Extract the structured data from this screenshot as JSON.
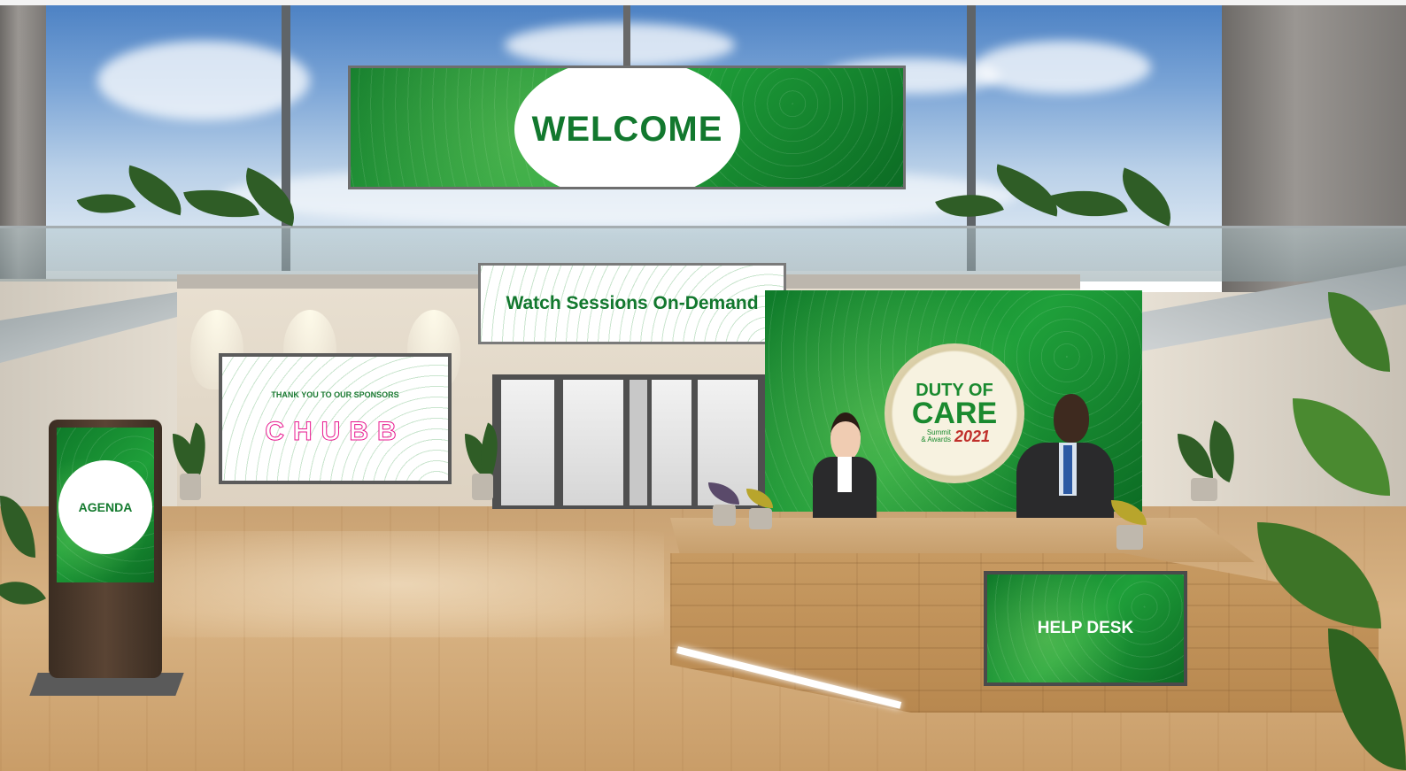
{
  "scene": {
    "welcome_banner": {
      "text": "WELCOME"
    },
    "sessions_sign": {
      "text": "Watch Sessions On-Demand"
    },
    "sponsors_screen": {
      "heading": "THANK YOU TO OUR SPONSORS",
      "sponsor_logo": "CHUBB"
    },
    "event_branding": {
      "line1": "DUTY OF",
      "line2": "CARE",
      "line3a": "Summit",
      "line3b": "& Awards",
      "year": "2021"
    },
    "agenda_kiosk": {
      "label": "AGENDA"
    },
    "help_desk": {
      "label": "HELP DESK"
    }
  },
  "colors": {
    "brand_green": "#12782e",
    "sponsor_magenta": "#e8188f",
    "year_red": "#c0302b"
  }
}
